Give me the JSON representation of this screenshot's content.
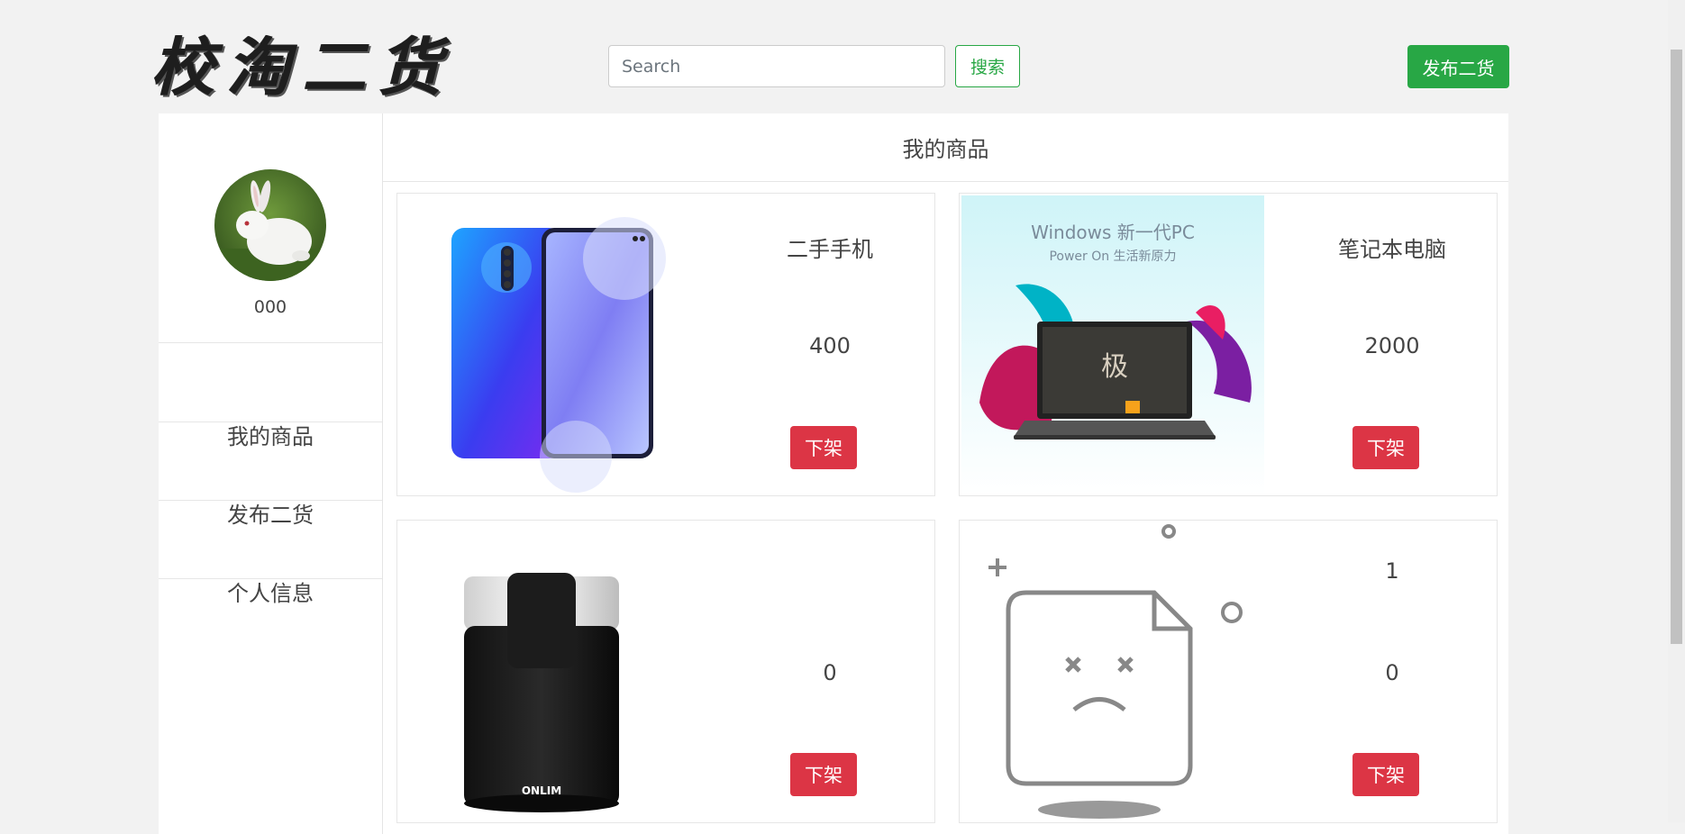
{
  "header": {
    "logo_text": "校淘二货",
    "search_placeholder": "Search",
    "search_button": "搜索",
    "publish_button": "发布二货"
  },
  "sidebar": {
    "username": "000",
    "items": [
      {
        "label": "我的商品"
      },
      {
        "label": "发布二货"
      },
      {
        "label": "个人信息"
      }
    ]
  },
  "main": {
    "title": "我的商品",
    "products": [
      {
        "name": "二手手机",
        "price": "400",
        "action": "下架",
        "image": "phone-image"
      },
      {
        "name": "笔记本电脑",
        "price": "2000",
        "action": "下架",
        "image": "laptop-image",
        "image_text": {
          "line1": "Windows 新一代PC",
          "line2": "Power On 生活新原力"
        }
      },
      {
        "name": "",
        "price": "0",
        "action": "下架",
        "image": "grinder-image",
        "image_brand": "ONLIM"
      },
      {
        "name": "1",
        "price": "0",
        "action": "下架",
        "image": "broken-image-icon"
      }
    ]
  },
  "colors": {
    "success": "#28a745",
    "danger": "#dc3545",
    "background": "#f2f2f2"
  }
}
